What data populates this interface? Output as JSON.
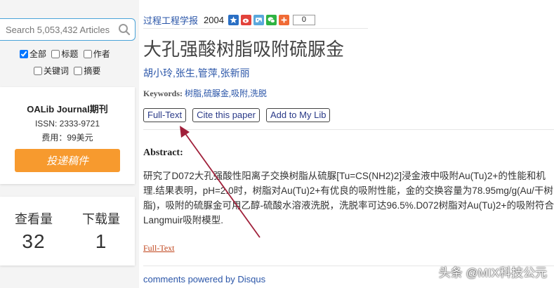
{
  "search": {
    "placeholder": "Search 5,053,432 Articles"
  },
  "filters": {
    "all": "全部",
    "title": "标题",
    "author": "作者",
    "keywords": "关键词",
    "abstract": "摘要"
  },
  "journal": {
    "name": "OALib Journal期刊",
    "issn": "ISSN: 2333-9721",
    "fee": "费用：99美元",
    "submit_label": "投递稿件"
  },
  "stats": {
    "views_label": "查看量",
    "views_value": "32",
    "downloads_label": "下载量",
    "downloads_value": "1"
  },
  "article": {
    "journal": "过程工程学报",
    "year": "2004",
    "share_count": "0",
    "title": "大孔强酸树脂吸附硫脲金",
    "authors": "胡小玲,张生,管萍,张新丽",
    "keywords_label": "Keywords:",
    "keywords": "树脂,硫脲金,吸附,洗脱",
    "buttons": {
      "fulltext": "Full-Text",
      "cite": "Cite this paper",
      "add": "Add to My Lib"
    },
    "abstract_label": "Abstract:",
    "abstract": "研究了D072大孔强酸性阳离子交换树脂从硫脲[Tu=CS(NH2)2]浸金液中吸附Au(Tu)2+的性能和机理.结果表明，pH=2.0时，树脂对Au(Tu)2+有优良的吸附性能，金的交换容量为78.95mg/g(Au/干树脂)，吸附的硫脲金可用乙醇-硫酸水溶液洗脱，洗脱率可达96.5%.D072树脂对Au(Tu)2+的吸附符合Langmuir吸附模型.",
    "fulltext_link": "Full-Text"
  },
  "footer": {
    "disqus": "comments powered by Disqus"
  },
  "watermark": "头条 @MIX科技公元",
  "colors": {
    "accent_orange": "#f79a2e",
    "link_blue": "#2a55a8",
    "arrow": "#a0203a"
  }
}
